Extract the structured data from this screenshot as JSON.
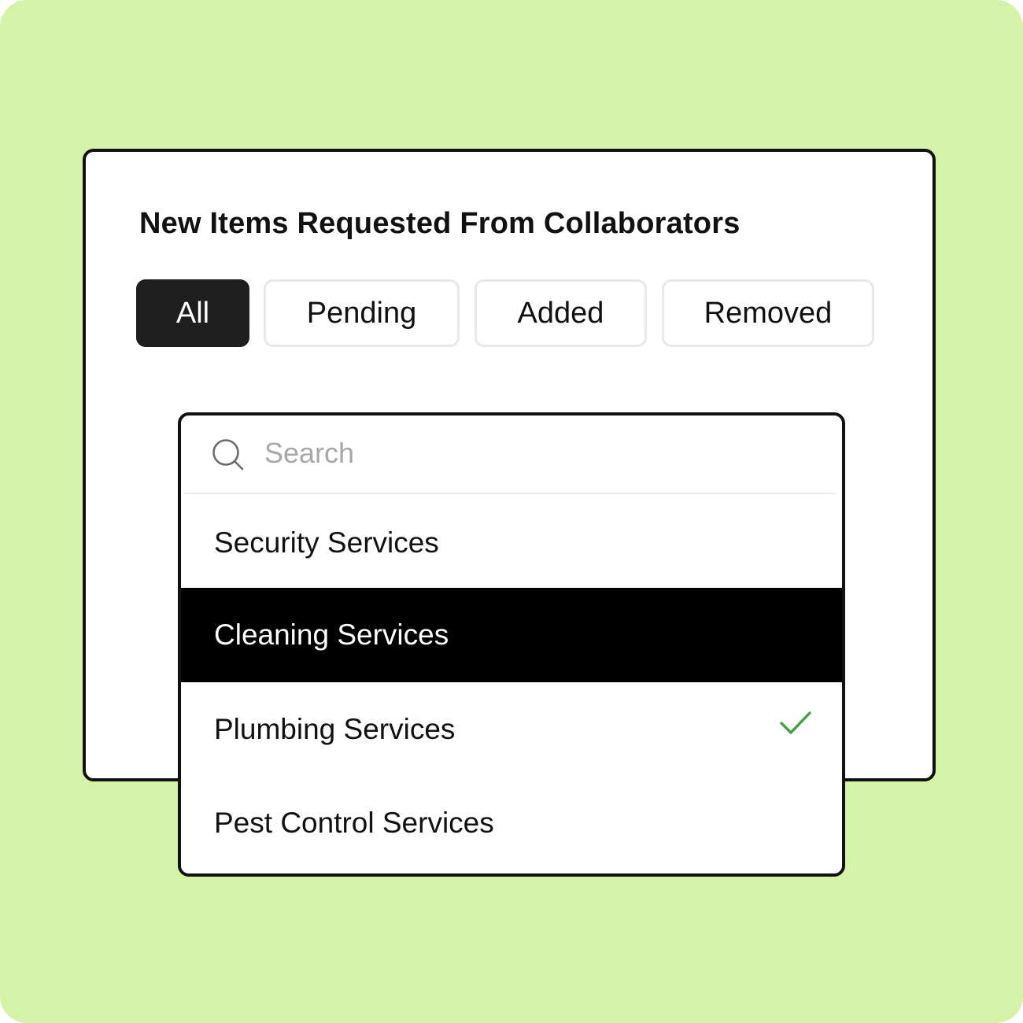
{
  "theme": {
    "background": "#d4f2a8",
    "active_tab_bg": "#1e1e1e",
    "highlight_bg": "#000000",
    "check_color": "#43a047"
  },
  "panel": {
    "title": "New Items Requested From Collaborators",
    "tabs": [
      {
        "label": "All",
        "active": true
      },
      {
        "label": "Pending",
        "active": false
      },
      {
        "label": "Added",
        "active": false
      },
      {
        "label": "Removed",
        "active": false
      }
    ]
  },
  "dropdown": {
    "search": {
      "placeholder": "Search",
      "value": "",
      "icon": "search-icon"
    },
    "options": [
      {
        "label": "Security Services",
        "highlighted": false,
        "selected": false
      },
      {
        "label": "Cleaning Services",
        "highlighted": true,
        "selected": false
      },
      {
        "label": "Plumbing Services",
        "highlighted": false,
        "selected": true,
        "icon": "check-icon"
      },
      {
        "label": "Pest Control Services",
        "highlighted": false,
        "selected": false
      }
    ]
  }
}
